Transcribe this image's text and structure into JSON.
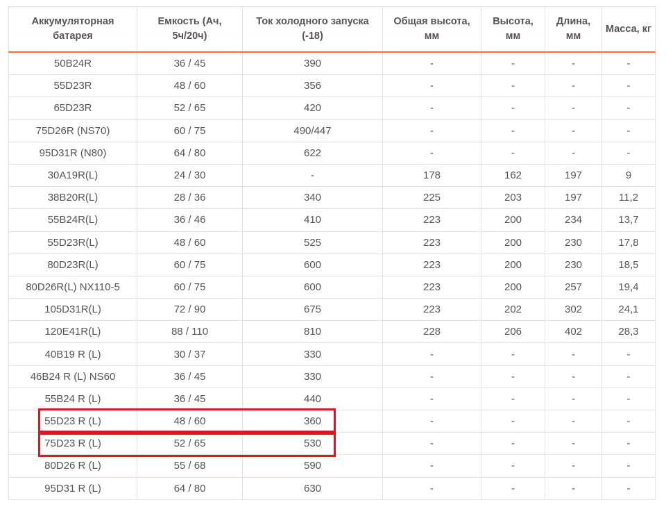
{
  "table": {
    "headers": [
      "Аккумуляторная батарея",
      "Емкость (Ач, 5ч/20ч)",
      "Ток холодного запуска (-18)",
      "Общая высота, мм",
      "Высота, мм",
      "Длина, мм",
      "Масса, кг"
    ],
    "rows": [
      [
        "50B24R",
        "36 / 45",
        "390",
        "-",
        "-",
        "-",
        "-"
      ],
      [
        "55D23R",
        "48 / 60",
        "356",
        "-",
        "-",
        "-",
        "-"
      ],
      [
        "65D23R",
        "52 / 65",
        "420",
        "-",
        "-",
        "-",
        "-"
      ],
      [
        "75D26R (NS70)",
        "60 / 75",
        "490/447",
        "-",
        "-",
        "-",
        "-"
      ],
      [
        "95D31R (N80)",
        "64 / 80",
        "622",
        "-",
        "-",
        "-",
        "-"
      ],
      [
        "30A19R(L)",
        "24 / 30",
        "-",
        "178",
        "162",
        "197",
        "9"
      ],
      [
        "38B20R(L)",
        "28 / 36",
        "340",
        "225",
        "203",
        "197",
        "11,2"
      ],
      [
        "55B24R(L)",
        "36 / 46",
        "410",
        "223",
        "200",
        "234",
        "13,7"
      ],
      [
        "55D23R(L)",
        "48 / 60",
        "525",
        "223",
        "200",
        "230",
        "17,8"
      ],
      [
        "80D23R(L)",
        "60 / 75",
        "600",
        "223",
        "200",
        "230",
        "18,5"
      ],
      [
        "80D26R(L) NX110-5",
        "60 / 75",
        "600",
        "223",
        "200",
        "257",
        "19,4"
      ],
      [
        "105D31R(L)",
        "72 / 90",
        "675",
        "223",
        "202",
        "302",
        "24,1"
      ],
      [
        "120E41R(L)",
        "88 / 110",
        "810",
        "228",
        "206",
        "402",
        "28,3"
      ],
      [
        "40B19 R (L)",
        "30 / 37",
        "330",
        "-",
        "-",
        "-",
        "-"
      ],
      [
        "46B24 R (L) NS60",
        "36 / 45",
        "330",
        "-",
        "-",
        "-",
        "-"
      ],
      [
        "55B24 R (L)",
        "36 / 45",
        "440",
        "-",
        "-",
        "-",
        "-"
      ],
      [
        "55D23 R (L)",
        "48 / 60",
        "360",
        "-",
        "-",
        "-",
        "-"
      ],
      [
        "75D23 R (L)",
        "52 / 65",
        "530",
        "-",
        "-",
        "-",
        "-"
      ],
      [
        "80D26 R (L)",
        "55 / 68",
        "590",
        "-",
        "-",
        "-",
        "-"
      ],
      [
        "95D31 R (L)",
        "64 / 80",
        "630",
        "-",
        "-",
        "-",
        "-"
      ]
    ],
    "highlighted_rows": [
      "55D23 R (L)",
      "75D23 R (L)"
    ],
    "colors": {
      "header_border": "#f26f3a",
      "highlight": "#e3131f",
      "grid": "#e2e2e2",
      "text": "#555555"
    }
  }
}
